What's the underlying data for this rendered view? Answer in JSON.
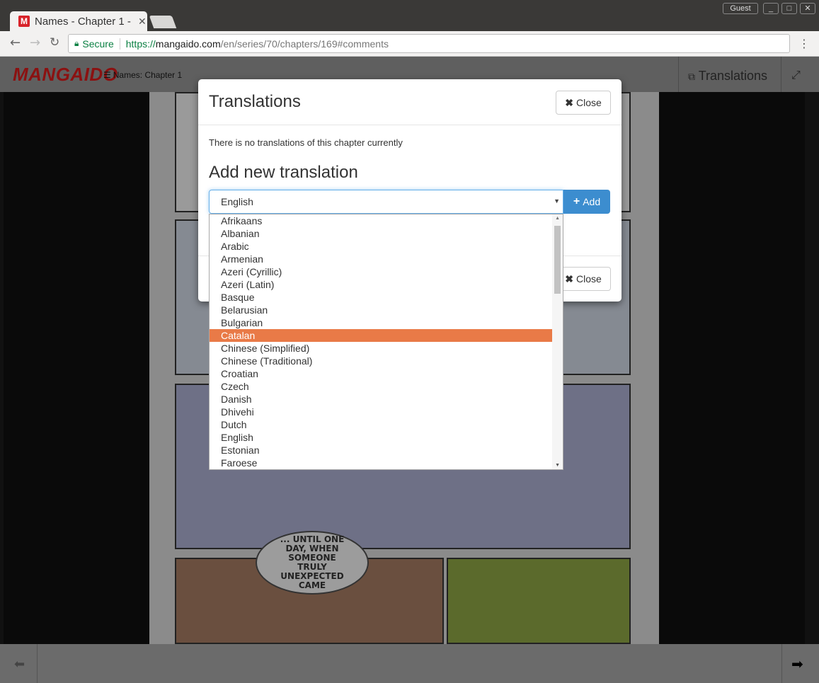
{
  "browser": {
    "tab_title": "Names - Chapter 1 -",
    "tab_favicon": "M",
    "secure_label": "Secure",
    "url_scheme": "https://",
    "url_host": "mangaido.com",
    "url_rest": "/en/series/70/chapters/169#comments",
    "guest_label": "Guest"
  },
  "site": {
    "logo": "MANGAIDO",
    "chapter_link": "Names: Chapter 1",
    "translations_btn": "Translations"
  },
  "manga": {
    "bubble_text": "... UNTIL ONE DAY, WHEN SOMEONE TRULY UNEXPECTED CAME"
  },
  "modal": {
    "title": "Translations",
    "close_label": "Close",
    "no_translations": "There is no translations of this chapter currently",
    "add_heading": "Add new translation",
    "selected_language": "English",
    "add_label": "Add"
  },
  "dropdown": {
    "options": [
      "Afrikaans",
      "Albanian",
      "Arabic",
      "Armenian",
      "Azeri (Cyrillic)",
      "Azeri (Latin)",
      "Basque",
      "Belarusian",
      "Bulgarian",
      "Catalan",
      "Chinese (Simplified)",
      "Chinese (Traditional)",
      "Croatian",
      "Czech",
      "Danish",
      "Dhivehi",
      "Dutch",
      "English",
      "Estonian",
      "Faroese"
    ],
    "highlighted": "Catalan"
  }
}
